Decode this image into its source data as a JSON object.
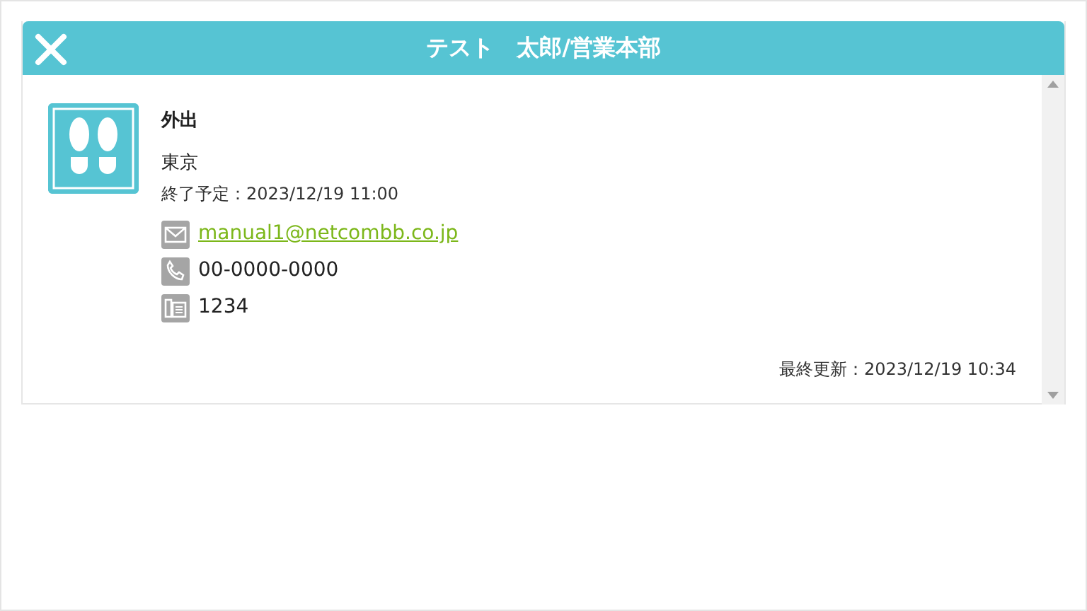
{
  "header": {
    "title": "テスト　太郎/営業本部"
  },
  "status": {
    "label": "外出",
    "location": "東京",
    "end_time": "終了予定：2023/12/19 11:00"
  },
  "contacts": [
    {
      "kind": "email",
      "value": "manual1@netcombb.co.jp"
    },
    {
      "kind": "phone",
      "value": "00-0000-0000"
    },
    {
      "kind": "extension",
      "value": "1234"
    }
  ],
  "last_updated": "最終更新：2023/12/19 10:34"
}
